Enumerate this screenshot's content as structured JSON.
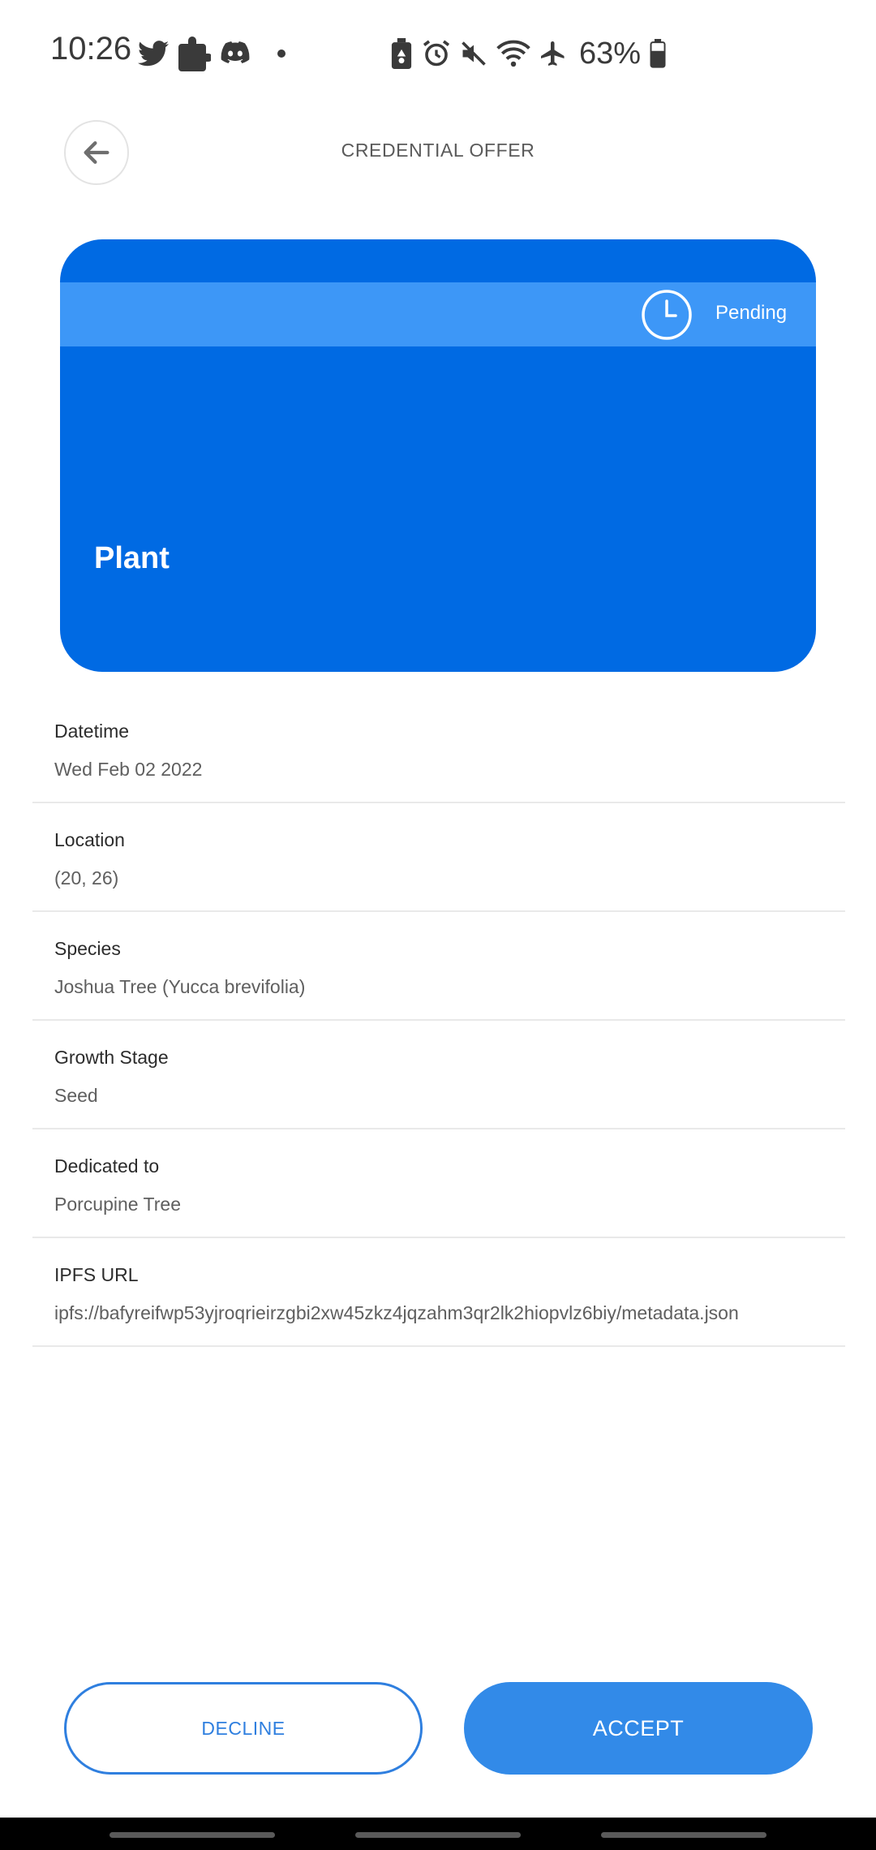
{
  "status_bar": {
    "time": "10:26",
    "left_icons": [
      "twitter-icon",
      "puzzle-icon",
      "discord-icon",
      "notification-dot-icon"
    ],
    "right_icons": [
      "battery-saver-icon",
      "alarm-icon",
      "mute-icon",
      "wifi-icon",
      "airplane-mode-icon",
      "battery-icon"
    ],
    "battery_percent": "63%"
  },
  "header": {
    "back_icon": "arrow-left-icon",
    "title": "CREDENTIAL OFFER"
  },
  "card": {
    "status_icon": "clock-icon",
    "status": "Pending",
    "title": "Plant",
    "colors": {
      "background": "#006ae3",
      "status_band": "#3d97f7"
    }
  },
  "fields": [
    {
      "label": "Datetime",
      "value": "Wed Feb 02 2022"
    },
    {
      "label": "Location",
      "value": "(20, 26)"
    },
    {
      "label": "Species",
      "value": "Joshua Tree (Yucca brevifolia)"
    },
    {
      "label": "Growth Stage",
      "value": "Seed"
    },
    {
      "label": "Dedicated to",
      "value": "Porcupine Tree"
    },
    {
      "label": "IPFS URL",
      "value": "ipfs://bafyreifwp53yjroqrieirzgbi2xw45zkz4jqzahm3qr2lk2hiopvlz6biy/metadata.json"
    }
  ],
  "actions": {
    "decline_label": "DECLINE",
    "accept_label": "ACCEPT",
    "accent_color": "#328ae8"
  }
}
